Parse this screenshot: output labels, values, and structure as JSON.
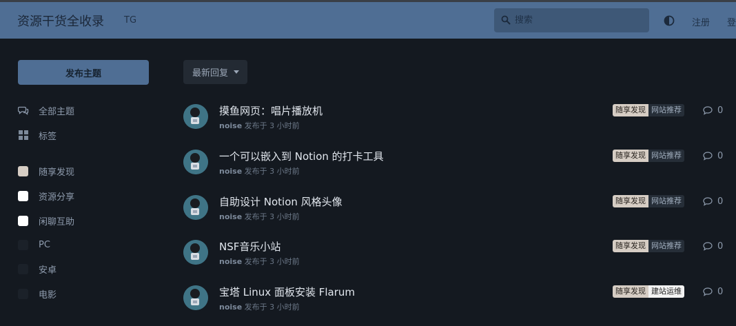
{
  "header": {
    "site_title": "资源干货全收录",
    "tg_label": "TG",
    "search_placeholder": "搜索",
    "register_label": "注册",
    "login_label": "登"
  },
  "sidebar": {
    "start_discussion_label": "发布主题",
    "nav": [
      {
        "label": "全部主题",
        "icon": "comments-icon"
      },
      {
        "label": "标签",
        "icon": "tags-grid-icon"
      }
    ],
    "tags": [
      {
        "label": "随享发现",
        "color": "#d6cdc4"
      },
      {
        "label": "资源分享",
        "color": "#ffffff"
      },
      {
        "label": "闲聊互助",
        "color": "#ffffff"
      },
      {
        "label": "PC",
        "color": "#1b2129"
      },
      {
        "label": "安卓",
        "color": "#1b2129"
      },
      {
        "label": "电影",
        "color": "#1b2129"
      }
    ]
  },
  "toolbar": {
    "sort_label": "最新回复"
  },
  "discussions": [
    {
      "title": "摸鱼网页：唱片播放机",
      "author": "noise",
      "meta": "发布于 3 小时前",
      "tag_primary": "随享发现",
      "tag_secondary": "网站推荐",
      "replies": "0"
    },
    {
      "title": "一个可以嵌入到 Notion 的打卡工具",
      "author": "noise",
      "meta": "发布于 3 小时前",
      "tag_primary": "随享发现",
      "tag_secondary": "网站推荐",
      "replies": "0"
    },
    {
      "title": "自助设计 Notion 风格头像",
      "author": "noise",
      "meta": "发布于 3 小时前",
      "tag_primary": "随享发现",
      "tag_secondary": "网站推荐",
      "replies": "0"
    },
    {
      "title": "NSF音乐小站",
      "author": "noise",
      "meta": "发布于 3 小时前",
      "tag_primary": "随享发现",
      "tag_secondary": "网站推荐",
      "replies": "0"
    },
    {
      "title": "宝塔 Linux 面板安装 Flarum",
      "author": "noise",
      "meta": "发布于 3 小时前",
      "tag_primary": "随享发现",
      "tag_secondary": "建站运维",
      "replies": "0"
    }
  ],
  "colors": {
    "header_bg": "#4f6e94",
    "page_bg": "#141920",
    "tag_discover": "#d6cdc4"
  }
}
